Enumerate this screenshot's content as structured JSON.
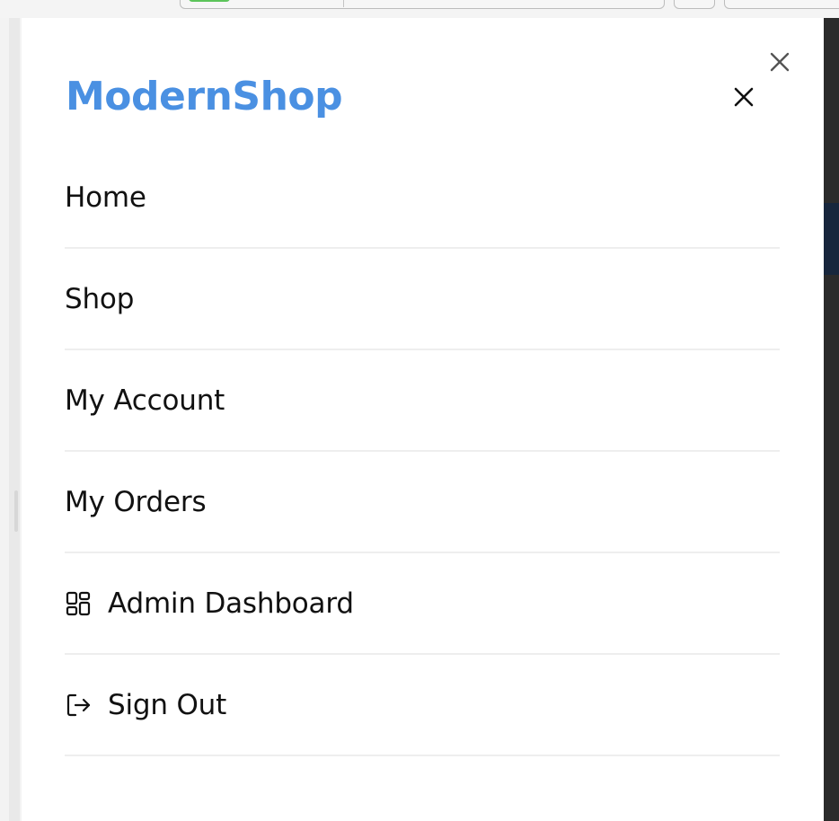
{
  "brand": {
    "name": "ModernShop",
    "color": "#4a90e2"
  },
  "drawer": {
    "outer_close_icon": "close-icon",
    "inner_close_icon": "close-icon"
  },
  "nav": {
    "items": [
      {
        "label": "Home",
        "icon": null
      },
      {
        "label": "Shop",
        "icon": null
      },
      {
        "label": "My Account",
        "icon": null
      },
      {
        "label": "My Orders",
        "icon": null
      },
      {
        "label": "Admin Dashboard",
        "icon": "dashboard-icon"
      },
      {
        "label": "Sign Out",
        "icon": "sign-out-icon"
      }
    ]
  },
  "colors": {
    "text": "#111111",
    "divider": "#eeeeee",
    "background_edge": "#2b2b2b"
  }
}
